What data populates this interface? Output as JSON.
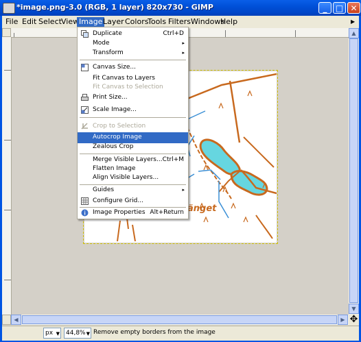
{
  "window": {
    "title": "*image.png-3.0 (RGB, 1 layer) 820x730 - GIMP",
    "controls": {
      "minimize": "_",
      "maximize": "□",
      "close": "✕"
    }
  },
  "menubar": {
    "items": [
      {
        "label": "File"
      },
      {
        "label": "Edit"
      },
      {
        "label": "Select"
      },
      {
        "label": "View"
      },
      {
        "label": "Image"
      },
      {
        "label": "Layer"
      },
      {
        "label": "Colors"
      },
      {
        "label": "Tools"
      },
      {
        "label": "Filters"
      },
      {
        "label": "Windows"
      },
      {
        "label": "Help"
      }
    ],
    "active": "Image"
  },
  "image_menu": {
    "items": [
      {
        "label": "Duplicate",
        "shortcut": "Ctrl+D",
        "icon": "duplicate-icon"
      },
      {
        "label": "Mode",
        "submenu": "▸"
      },
      {
        "label": "Transform",
        "submenu": "▸"
      },
      {
        "label": "Canvas Size...",
        "icon": "canvas-size-icon"
      },
      {
        "label": "Fit Canvas to Layers"
      },
      {
        "label": "Fit Canvas to Selection",
        "disabled": true
      },
      {
        "label": "Print Size...",
        "icon": "print-icon"
      },
      {
        "label": "Scale Image...",
        "icon": "scale-icon"
      },
      {
        "label": "Crop to Selection",
        "disabled": true,
        "icon": "crop-icon"
      },
      {
        "label": "Autocrop Image",
        "highlighted": true
      },
      {
        "label": "Zealous Crop"
      },
      {
        "label": "Merge Visible Layers...",
        "shortcut": "Ctrl+M"
      },
      {
        "label": "Flatten Image"
      },
      {
        "label": "Align Visible Layers..."
      },
      {
        "label": "Guides",
        "submenu": "▸"
      },
      {
        "label": "Configure Grid...",
        "icon": "grid-icon"
      },
      {
        "label": "Image Properties",
        "shortcut": "Alt+Return",
        "icon": "info-icon"
      }
    ]
  },
  "canvas": {
    "map_label": "änget"
  },
  "statusbar": {
    "unit": "px",
    "zoom": "44,8%",
    "message": "Remove empty borders from the image"
  },
  "colors": {
    "titlebar": "#0054e3",
    "highlight": "#316ac5",
    "map_road": "#c8691e",
    "map_water": "#66d6e0",
    "map_stream": "#3a8fd6",
    "selection_border": "#cfc000"
  }
}
